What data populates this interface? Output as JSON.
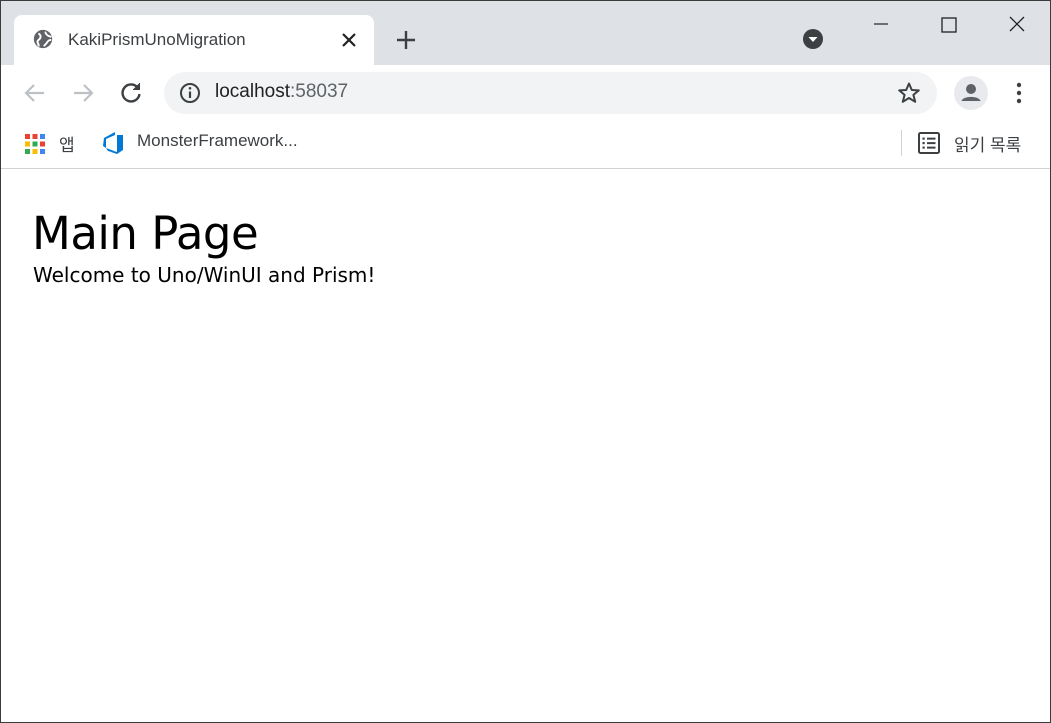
{
  "browser": {
    "tab": {
      "title": "KakiPrismUnoMigration",
      "favicon": "globe-icon"
    },
    "address_bar": {
      "host": "localhost",
      "port": ":58037"
    },
    "bookmarks": [
      {
        "label": "앱",
        "icon": "apps-grid-icon"
      },
      {
        "label": "MonsterFramework...",
        "icon": "azure-devops-icon"
      }
    ],
    "reading_list": {
      "label": "읽기 목록",
      "icon": "reading-list-icon"
    }
  },
  "page": {
    "title": "Main Page",
    "welcome": "Welcome to Uno/WinUI and Prism!"
  },
  "colors": {
    "tabstrip_bg": "#dee1e6",
    "omnibox_bg": "#f1f3f4",
    "icon_gray": "#5f6368",
    "devops_blue": "#0078d4"
  }
}
